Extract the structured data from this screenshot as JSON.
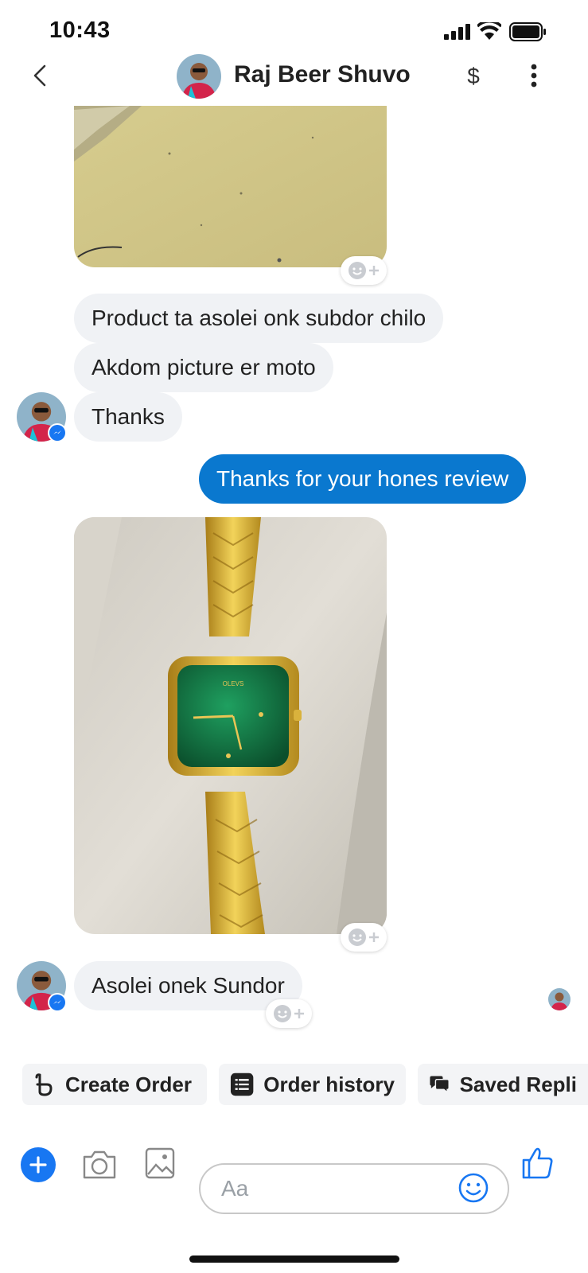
{
  "status_bar": {
    "time": "10:43"
  },
  "header": {
    "contact_name": "Raj Beer Shuvo",
    "back_icon": "chevron-left-icon",
    "payment_icon": "dollar-icon",
    "menu_icon": "more-vertical-icon"
  },
  "messages": {
    "incoming_1": "Product ta asolei onk subdor chilo",
    "incoming_2": "Akdom picture er moto",
    "incoming_3": "Thanks",
    "outgoing_1": "Thanks for your hones review",
    "incoming_4": "Asolei onek Sundor"
  },
  "quick_actions": {
    "create_order": "Create Order",
    "order_history": "Order history",
    "saved_replies": "Saved Repli"
  },
  "composer": {
    "placeholder": "Aa"
  },
  "colors": {
    "accent": "#1877f2",
    "outgoing_bubble": "#0a78cf",
    "incoming_bubble": "#f0f2f5"
  }
}
